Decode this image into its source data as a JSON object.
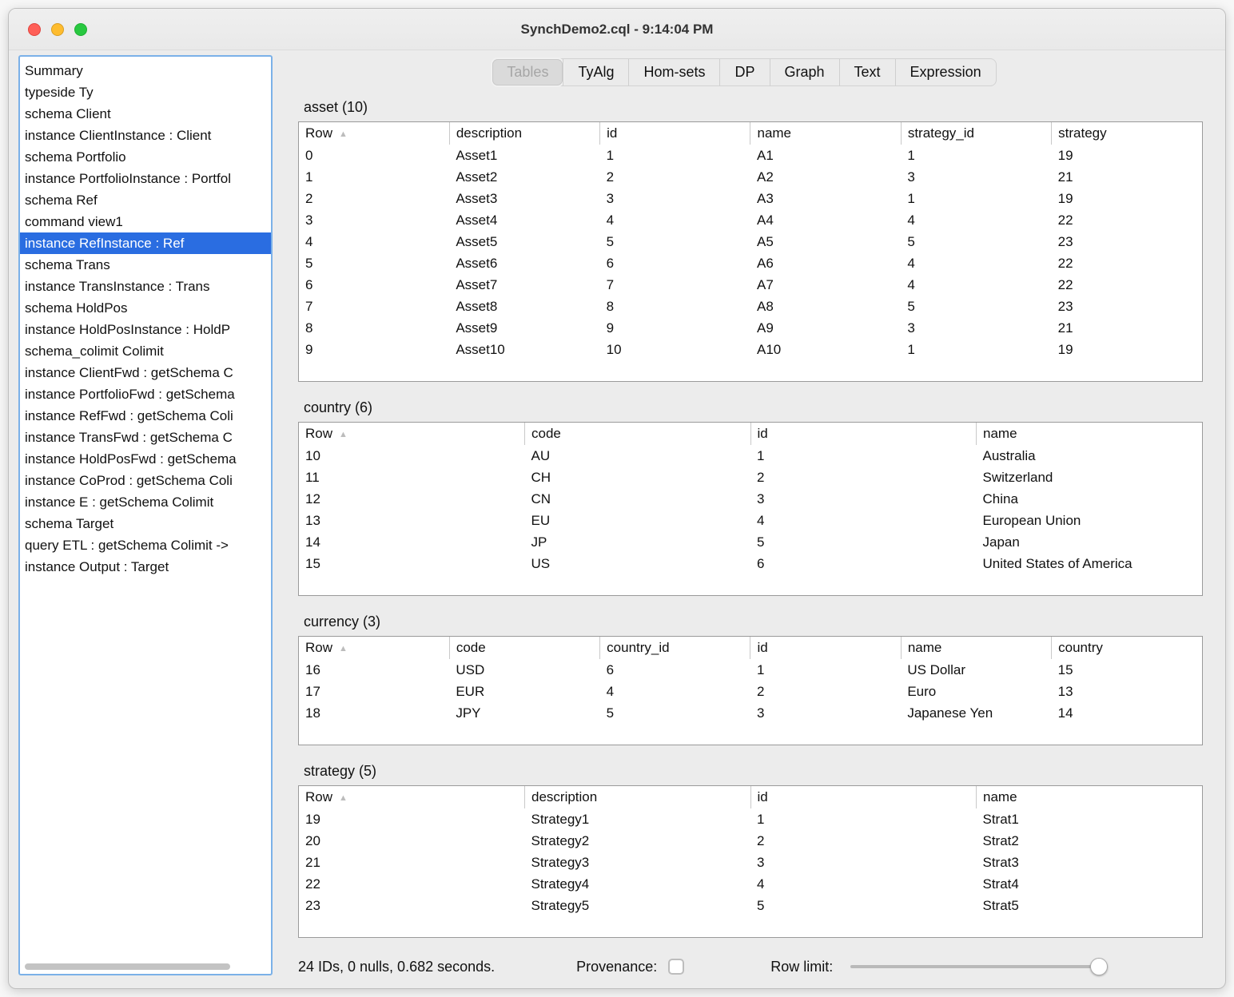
{
  "window": {
    "title": "SynchDemo2.cql - 9:14:04 PM"
  },
  "colors": {
    "selection_blue": "#2a6de1",
    "sidebar_focus_border": "#7bb1e8",
    "traffic_red": "#ff5f57",
    "traffic_yellow": "#febc2e",
    "traffic_green": "#28c840"
  },
  "icons": {
    "sort_ascending": "▲"
  },
  "sidebar": {
    "items": [
      {
        "label": "Summary",
        "selected": false
      },
      {
        "label": "typeside Ty",
        "selected": false
      },
      {
        "label": "schema Client",
        "selected": false
      },
      {
        "label": "instance ClientInstance : Client",
        "selected": false
      },
      {
        "label": "schema Portfolio",
        "selected": false
      },
      {
        "label": "instance PortfolioInstance : Portfol",
        "selected": false
      },
      {
        "label": "schema Ref",
        "selected": false
      },
      {
        "label": "command view1",
        "selected": false
      },
      {
        "label": "instance RefInstance : Ref",
        "selected": true
      },
      {
        "label": "schema Trans",
        "selected": false
      },
      {
        "label": "instance TransInstance : Trans",
        "selected": false
      },
      {
        "label": "schema HoldPos",
        "selected": false
      },
      {
        "label": "instance HoldPosInstance : HoldP",
        "selected": false
      },
      {
        "label": "schema_colimit Colimit",
        "selected": false
      },
      {
        "label": "instance ClientFwd : getSchema C",
        "selected": false
      },
      {
        "label": "instance PortfolioFwd : getSchema",
        "selected": false
      },
      {
        "label": "instance RefFwd : getSchema Coli",
        "selected": false
      },
      {
        "label": "instance TransFwd : getSchema C",
        "selected": false
      },
      {
        "label": "instance HoldPosFwd : getSchema",
        "selected": false
      },
      {
        "label": "instance CoProd : getSchema Coli",
        "selected": false
      },
      {
        "label": "instance E : getSchema Colimit",
        "selected": false
      },
      {
        "label": "schema Target",
        "selected": false
      },
      {
        "label": "query ETL : getSchema Colimit ->",
        "selected": false
      },
      {
        "label": "instance Output : Target",
        "selected": false
      }
    ]
  },
  "tabs": [
    {
      "label": "Tables",
      "selected": true
    },
    {
      "label": "TyAlg",
      "selected": false
    },
    {
      "label": "Hom-sets",
      "selected": false
    },
    {
      "label": "DP",
      "selected": false
    },
    {
      "label": "Graph",
      "selected": false
    },
    {
      "label": "Text",
      "selected": false
    },
    {
      "label": "Expression",
      "selected": false
    }
  ],
  "tables": [
    {
      "title": "asset (10)",
      "columns": [
        "Row",
        "description",
        "id",
        "name",
        "strategy_id",
        "strategy"
      ],
      "rows": [
        [
          "0",
          "Asset1",
          "1",
          "A1",
          "1",
          "19"
        ],
        [
          "1",
          "Asset2",
          "2",
          "A2",
          "3",
          "21"
        ],
        [
          "2",
          "Asset3",
          "3",
          "A3",
          "1",
          "19"
        ],
        [
          "3",
          "Asset4",
          "4",
          "A4",
          "4",
          "22"
        ],
        [
          "4",
          "Asset5",
          "5",
          "A5",
          "5",
          "23"
        ],
        [
          "5",
          "Asset6",
          "6",
          "A6",
          "4",
          "22"
        ],
        [
          "6",
          "Asset7",
          "7",
          "A7",
          "4",
          "22"
        ],
        [
          "7",
          "Asset8",
          "8",
          "A8",
          "5",
          "23"
        ],
        [
          "8",
          "Asset9",
          "9",
          "A9",
          "3",
          "21"
        ],
        [
          "9",
          "Asset10",
          "10",
          "A10",
          "1",
          "19"
        ]
      ]
    },
    {
      "title": "country (6)",
      "columns": [
        "Row",
        "code",
        "id",
        "name"
      ],
      "rows": [
        [
          "10",
          "AU",
          "1",
          "Australia"
        ],
        [
          "11",
          "CH",
          "2",
          "Switzerland"
        ],
        [
          "12",
          "CN",
          "3",
          "China"
        ],
        [
          "13",
          "EU",
          "4",
          "European Union"
        ],
        [
          "14",
          "JP",
          "5",
          "Japan"
        ],
        [
          "15",
          "US",
          "6",
          "United States of America"
        ]
      ]
    },
    {
      "title": "currency (3)",
      "columns": [
        "Row",
        "code",
        "country_id",
        "id",
        "name",
        "country"
      ],
      "rows": [
        [
          "16",
          "USD",
          "6",
          "1",
          "US Dollar",
          "15"
        ],
        [
          "17",
          "EUR",
          "4",
          "2",
          "Euro",
          "13"
        ],
        [
          "18",
          "JPY",
          "5",
          "3",
          "Japanese Yen",
          "14"
        ]
      ]
    },
    {
      "title": "strategy (5)",
      "columns": [
        "Row",
        "description",
        "id",
        "name"
      ],
      "rows": [
        [
          "19",
          "Strategy1",
          "1",
          "Strat1"
        ],
        [
          "20",
          "Strategy2",
          "2",
          "Strat2"
        ],
        [
          "21",
          "Strategy3",
          "3",
          "Strat3"
        ],
        [
          "22",
          "Strategy4",
          "4",
          "Strat4"
        ],
        [
          "23",
          "Strategy5",
          "5",
          "Strat5"
        ]
      ]
    }
  ],
  "status": {
    "summary": "24 IDs, 0 nulls, 0.682 seconds.",
    "provenance_label": "Provenance:",
    "provenance_checked": false,
    "row_limit_label": "Row limit:",
    "row_limit_value": "max"
  }
}
